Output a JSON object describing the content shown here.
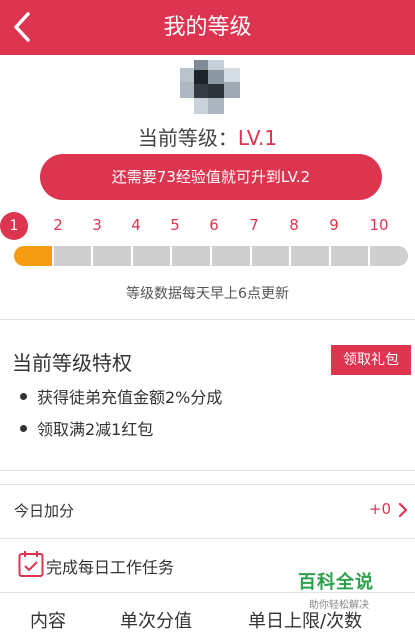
{
  "header": {
    "title": "我的等级"
  },
  "level": {
    "current_label": "当前等级：",
    "current_value": "LV.1",
    "upgrade_message": "还需要73经验值就可升到LV.2",
    "numbers": [
      "1",
      "2",
      "3",
      "4",
      "5",
      "6",
      "7",
      "8",
      "9",
      "10"
    ],
    "active_index": 0,
    "progress_fraction": 0.1,
    "update_note": "等级数据每天早上6点更新"
  },
  "privileges": {
    "title": "当前等级特权",
    "gift_button": "领取礼包",
    "items": [
      "获得徒弟充值金额2%分成",
      "领取满2减1红包"
    ]
  },
  "today": {
    "label": "今日加分",
    "value": "+0"
  },
  "task": {
    "label": "完成每日工作任务"
  },
  "table_header": {
    "col1": "内容",
    "col2": "单次分值",
    "col3": "单日上限/次数"
  },
  "watermark": {
    "main": "百科全说",
    "sub": "助你轻松解决"
  },
  "colors": {
    "accent": "#dd3450",
    "progress": "#f59c12",
    "track": "#cfcfcf",
    "watermark": "#2aa14a"
  },
  "icons": {
    "back": "chevron-left-icon",
    "avatar": "avatar-image",
    "chevron": "chevron-right-icon",
    "task": "calendar-check-icon"
  }
}
